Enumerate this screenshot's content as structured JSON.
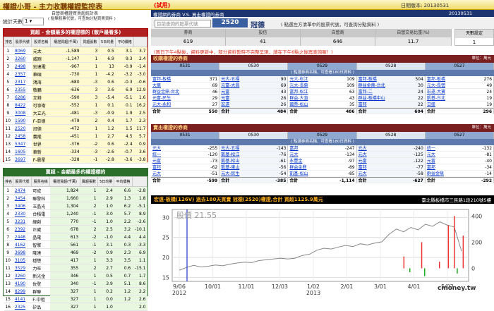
{
  "app": {
    "title": "權證小哥 - 主力收購權證監控表",
    "badge": "(試用)",
    "date_label": "日期版本:",
    "date": "20130531"
  },
  "left": {
    "subtitle": "自營商權證買賣超統計表",
    "days_label": "統計天數",
    "days_value": "1",
    "note": "( 點擊股票代號，可查詢分點買賣資料 )",
    "buy": {
      "title": "買超 - 金額最多的權證標的 (散戶最看多)",
      "headers": [
        "排名",
        "股票代號",
        "股票名稱",
        "權證買超(千萬)",
        "買超張數",
        "5日均量",
        "平均價格"
      ],
      "rows": [
        [
          "1",
          "8069",
          "元太",
          "-1,589",
          "3",
          "0.5",
          "3.1",
          "3.7"
        ],
        [
          "2",
          "3260",
          "威剛",
          "-1,147",
          "1",
          "6.9",
          "9.3",
          "2.4"
        ],
        [
          "3",
          "2498",
          "宏達電",
          "-967",
          "1",
          "13",
          "-0.9",
          "-1.4"
        ],
        [
          "4",
          "2357",
          "華碩",
          "-730",
          "1",
          "-4.2",
          "-3.2",
          "-3.0"
        ],
        [
          "5",
          "2317",
          "鴻海",
          "-680",
          "-3",
          "0.6",
          "-0.3",
          "-0.6"
        ],
        [
          "6",
          "2355",
          "敬鵬",
          "-636",
          "3",
          "3.6",
          "6.9",
          "12.9"
        ],
        [
          "7",
          "6286",
          "立錡",
          "-590",
          "3",
          "-5.4",
          "-5.1",
          "1.6"
        ],
        [
          "8",
          "8422",
          "可寧衛",
          "-552",
          "1",
          "0.1",
          "0.1",
          "16.2"
        ],
        [
          "9",
          "3008",
          "大立光",
          "-481",
          "-3",
          "-0.9",
          "1.9",
          "2.5"
        ],
        [
          "10",
          "1590",
          "F-亞德",
          "-479",
          "2",
          "0.4",
          "1.7",
          "2.3"
        ],
        [
          "11",
          "2520",
          "冠德",
          "-472",
          "1",
          "1.2",
          "1.5",
          "11.7"
        ],
        [
          "12",
          "2458",
          "義隆",
          "-451",
          "1",
          "2.7",
          "4.5",
          "5.7"
        ],
        [
          "13",
          "5347",
          "世界",
          "-376",
          "-2",
          "0.6",
          "-2.4",
          "0.9"
        ],
        [
          "14",
          "1605",
          "華新",
          "-334",
          "-3",
          "-2.6",
          "-0.7",
          "3.6"
        ],
        [
          "15",
          "3697",
          "F-晨星",
          "-328",
          "-1",
          "-2.8",
          "-3.6",
          "-3.8"
        ]
      ]
    },
    "sell": {
      "title": "賣超 - 金額最多的權證標的",
      "headers": [
        "排名",
        "股票代號",
        "股票名稱",
        "權證買超(千萬)",
        "賣超張數",
        "5日均量",
        "平均價格"
      ],
      "rows": [
        [
          "1",
          "2474",
          "可成",
          "1,824",
          "1",
          "2.4",
          "6.6",
          "-2.8"
        ],
        [
          "2",
          "3454",
          "聯發科",
          "1,660",
          "1",
          "2.9",
          "1.3",
          "1.8"
        ],
        [
          "3",
          "3406",
          "玉晶光",
          "1,304",
          "2",
          "1.0",
          "6.2",
          "-5.1"
        ],
        [
          "4",
          "2330",
          "台積電",
          "1,240",
          "-1",
          "3.0",
          "5.7",
          "8.9"
        ],
        [
          "5",
          "3231",
          "緯創",
          "770",
          "-1",
          "1.0",
          "2.2",
          "-2.6"
        ],
        [
          "6",
          "2392",
          "正崴",
          "678",
          "2",
          "2.5",
          "3.2",
          "-10.1"
        ],
        [
          "7",
          "2448",
          "晶電",
          "613",
          "-2",
          "-1.0",
          "4.4",
          "4.4"
        ],
        [
          "8",
          "4162",
          "智擎",
          "561",
          "-1",
          "3.1",
          "0.3",
          "-3.3"
        ],
        [
          "9",
          "3698",
          "隆達",
          "469",
          "-2",
          "0.9",
          "2.3",
          "6.9"
        ],
        [
          "10",
          "3105",
          "穩懋",
          "417",
          "1",
          "3.3",
          "3.5",
          "1.1"
        ],
        [
          "11",
          "3529",
          "力旺",
          "355",
          "2",
          "2.7",
          "0.6",
          "-15.1"
        ],
        [
          "12",
          "3260",
          "新光金",
          "346",
          "1",
          "0.5",
          "0.7",
          "1.7"
        ],
        [
          "13",
          "4190",
          "佐登",
          "340",
          "-1",
          "3.9",
          "5.1",
          "8.6"
        ],
        [
          "14",
          "8299",
          "群聯",
          "327",
          "1",
          "0.2",
          "1.2",
          "2.2"
        ],
        [
          "15",
          "4141",
          "F-中租",
          "327",
          "1",
          "0.0",
          "1.2",
          "2.6"
        ],
        [
          "16",
          "2325",
          "矽品",
          "327",
          "1",
          "1.0",
          "",
          "2.0"
        ]
      ]
    }
  },
  "right": {
    "title": "權證網的券商 V.S. 買走權證的券商",
    "query_label": "目前查詢的股票代號",
    "query_code": "2520",
    "query_name": "冠德",
    "query_note": "( 點選左方清單中的股票代號，可查詢分點資料 )",
    "summary_headers": [
      "券商",
      "投信",
      "自營商",
      "自營交易比重(%)"
    ],
    "summary_values": [
      "619",
      "41",
      "646",
      "11.7"
    ],
    "box_label": "天數設定",
    "box_value": "1",
    "warning": "(買日下午4點後，資料更新中，部分資料暫時不完整呈現，請在下午6點之後再查詢喔！)",
    "buy_title": "收購權證的券商",
    "unit": "單位：萬元",
    "dates": [
      "0531",
      "0530",
      "0529",
      "0528",
      "0527"
    ],
    "sub": "( 點選券商名稱，可查看180日資料 )",
    "buy_cols": [
      [
        [
          "富邦-板橋",
          "371"
        ],
        [
          "大華",
          "69"
        ],
        [
          "群益金鼎-台北",
          "46"
        ],
        [
          "元富-民生",
          "29"
        ],
        [
          "元大-永和",
          "27"
        ]
      ],
      [
        [
          "元大-五福",
          "90"
        ],
        [
          "元富-大昌",
          "69"
        ],
        [
          "元富",
          "43"
        ],
        [
          "元富",
          "26"
        ],
        [
          "宏遠",
          "26"
        ]
      ],
      [
        [
          "元大-松江",
          "109"
        ],
        [
          "元大-長榮",
          "109"
        ],
        [
          "富邦-松江",
          "63"
        ],
        [
          "群益-大直",
          "43"
        ],
        [
          "國票-松山",
          "35"
        ]
      ],
      [
        [
          "富邦-板橋",
          "504"
        ],
        [
          "群益金鼎-台北",
          "30"
        ],
        [
          "富邦-二",
          "24"
        ],
        [
          "群益-板橋中山",
          "22"
        ],
        [
          "富邦",
          "22"
        ]
      ],
      [
        [
          "富邦-板橋",
          "276"
        ],
        [
          "元大-長營",
          "49"
        ],
        [
          "宏遠-大寶",
          "24"
        ],
        [
          "凱基-台北",
          "19"
        ],
        [
          "日盛",
          "19"
        ]
      ]
    ],
    "buy_totals": [
      "550",
      "484",
      "486",
      "604",
      "296"
    ],
    "sell_title": "賣出權證的券商",
    "sell_cols": [
      [
        [
          "元大",
          "-255"
        ],
        [
          "統一",
          "-120"
        ],
        [
          "元富",
          "-73"
        ],
        [
          "富邦",
          "-62"
        ],
        [
          "元大",
          "-51"
        ]
      ],
      [
        [
          "元大-五福",
          "-143"
        ],
        [
          "凱基-松江",
          "-76"
        ],
        [
          "凱基-松山",
          "-61"
        ],
        [
          "凱基-東山",
          "-56"
        ],
        [
          "元大-民生",
          "-54"
        ]
      ],
      [
        [
          "富邦",
          "-247"
        ],
        [
          "元大",
          "-134"
        ],
        [
          "永豐金",
          "-97"
        ],
        [
          "群益金鼎",
          "-89"
        ],
        [
          "凱基-松山",
          "-85"
        ]
      ],
      [
        [
          "元大",
          "-240"
        ],
        [
          "元大",
          "-125"
        ],
        [
          "元富",
          "-122"
        ],
        [
          "富邦",
          "-77"
        ],
        [
          "元大",
          "-58"
        ]
      ],
      [
        [
          "統一",
          "-132"
        ],
        [
          "元大",
          "-81"
        ],
        [
          "元富",
          "-40"
        ],
        [
          "富邦",
          "-34"
        ],
        [
          "群益金鼎",
          "-14"
        ]
      ]
    ],
    "sell_totals": [
      "-599",
      "-385",
      "-1,114",
      "-627",
      "-292"
    ],
    "total_label": "合計"
  },
  "chart_data": {
    "type": "line",
    "title": "宏遠-板橋(126V) 過去180天買賣 冠德(2520)權證,合計 買超1125.9萬元",
    "address": "臺北縣板橋市三民路1段210號5樓",
    "price_label": "股價",
    "price_value": "21.55",
    "xticks": [
      "9/06\n2012",
      "10/01",
      "11/01",
      "12/03",
      "1/02\n2013",
      "2/01",
      "3/01",
      "4/01",
      "5/02"
    ],
    "yleft": [
      15,
      20,
      25,
      30
    ],
    "yright": [
      0,
      200,
      400
    ],
    "series": [
      {
        "name": "股價",
        "values": [
          16.8,
          17.5,
          18.0,
          17.6,
          17.8,
          18.1,
          17.9,
          18.3,
          18.6,
          18.8,
          18.7,
          19.2,
          19.4,
          19.6,
          19.8,
          19.6,
          19.8,
          20.5,
          20.8,
          21.8,
          22.3,
          22.1,
          22.6,
          23.0,
          22.7,
          23.4,
          23.1,
          23.6,
          23.9,
          25.8,
          27.1,
          26.4,
          27.5,
          26.9,
          28.3,
          27.8,
          28.9,
          28.1,
          27.6,
          21.55
        ]
      }
    ],
    "bars": [
      {
        "pos": 0.78,
        "value": 90,
        "color": "#e33"
      },
      {
        "pos": 0.8,
        "value": -30,
        "color": "#2a2"
      },
      {
        "pos": 0.84,
        "value": 200,
        "color": "#e33"
      },
      {
        "pos": 0.85,
        "value": -60,
        "color": "#2a2"
      },
      {
        "pos": 0.9,
        "value": 50,
        "color": "#e33"
      },
      {
        "pos": 0.93,
        "value": 330,
        "color": "#e33"
      },
      {
        "pos": 0.95,
        "value": 400,
        "color": "#e33"
      },
      {
        "pos": 0.96,
        "value": -40,
        "color": "#2a2"
      },
      {
        "pos": 0.98,
        "value": 250,
        "color": "#e33"
      }
    ],
    "marker_pos": 0.05,
    "watermark": "cmoney.tw"
  }
}
